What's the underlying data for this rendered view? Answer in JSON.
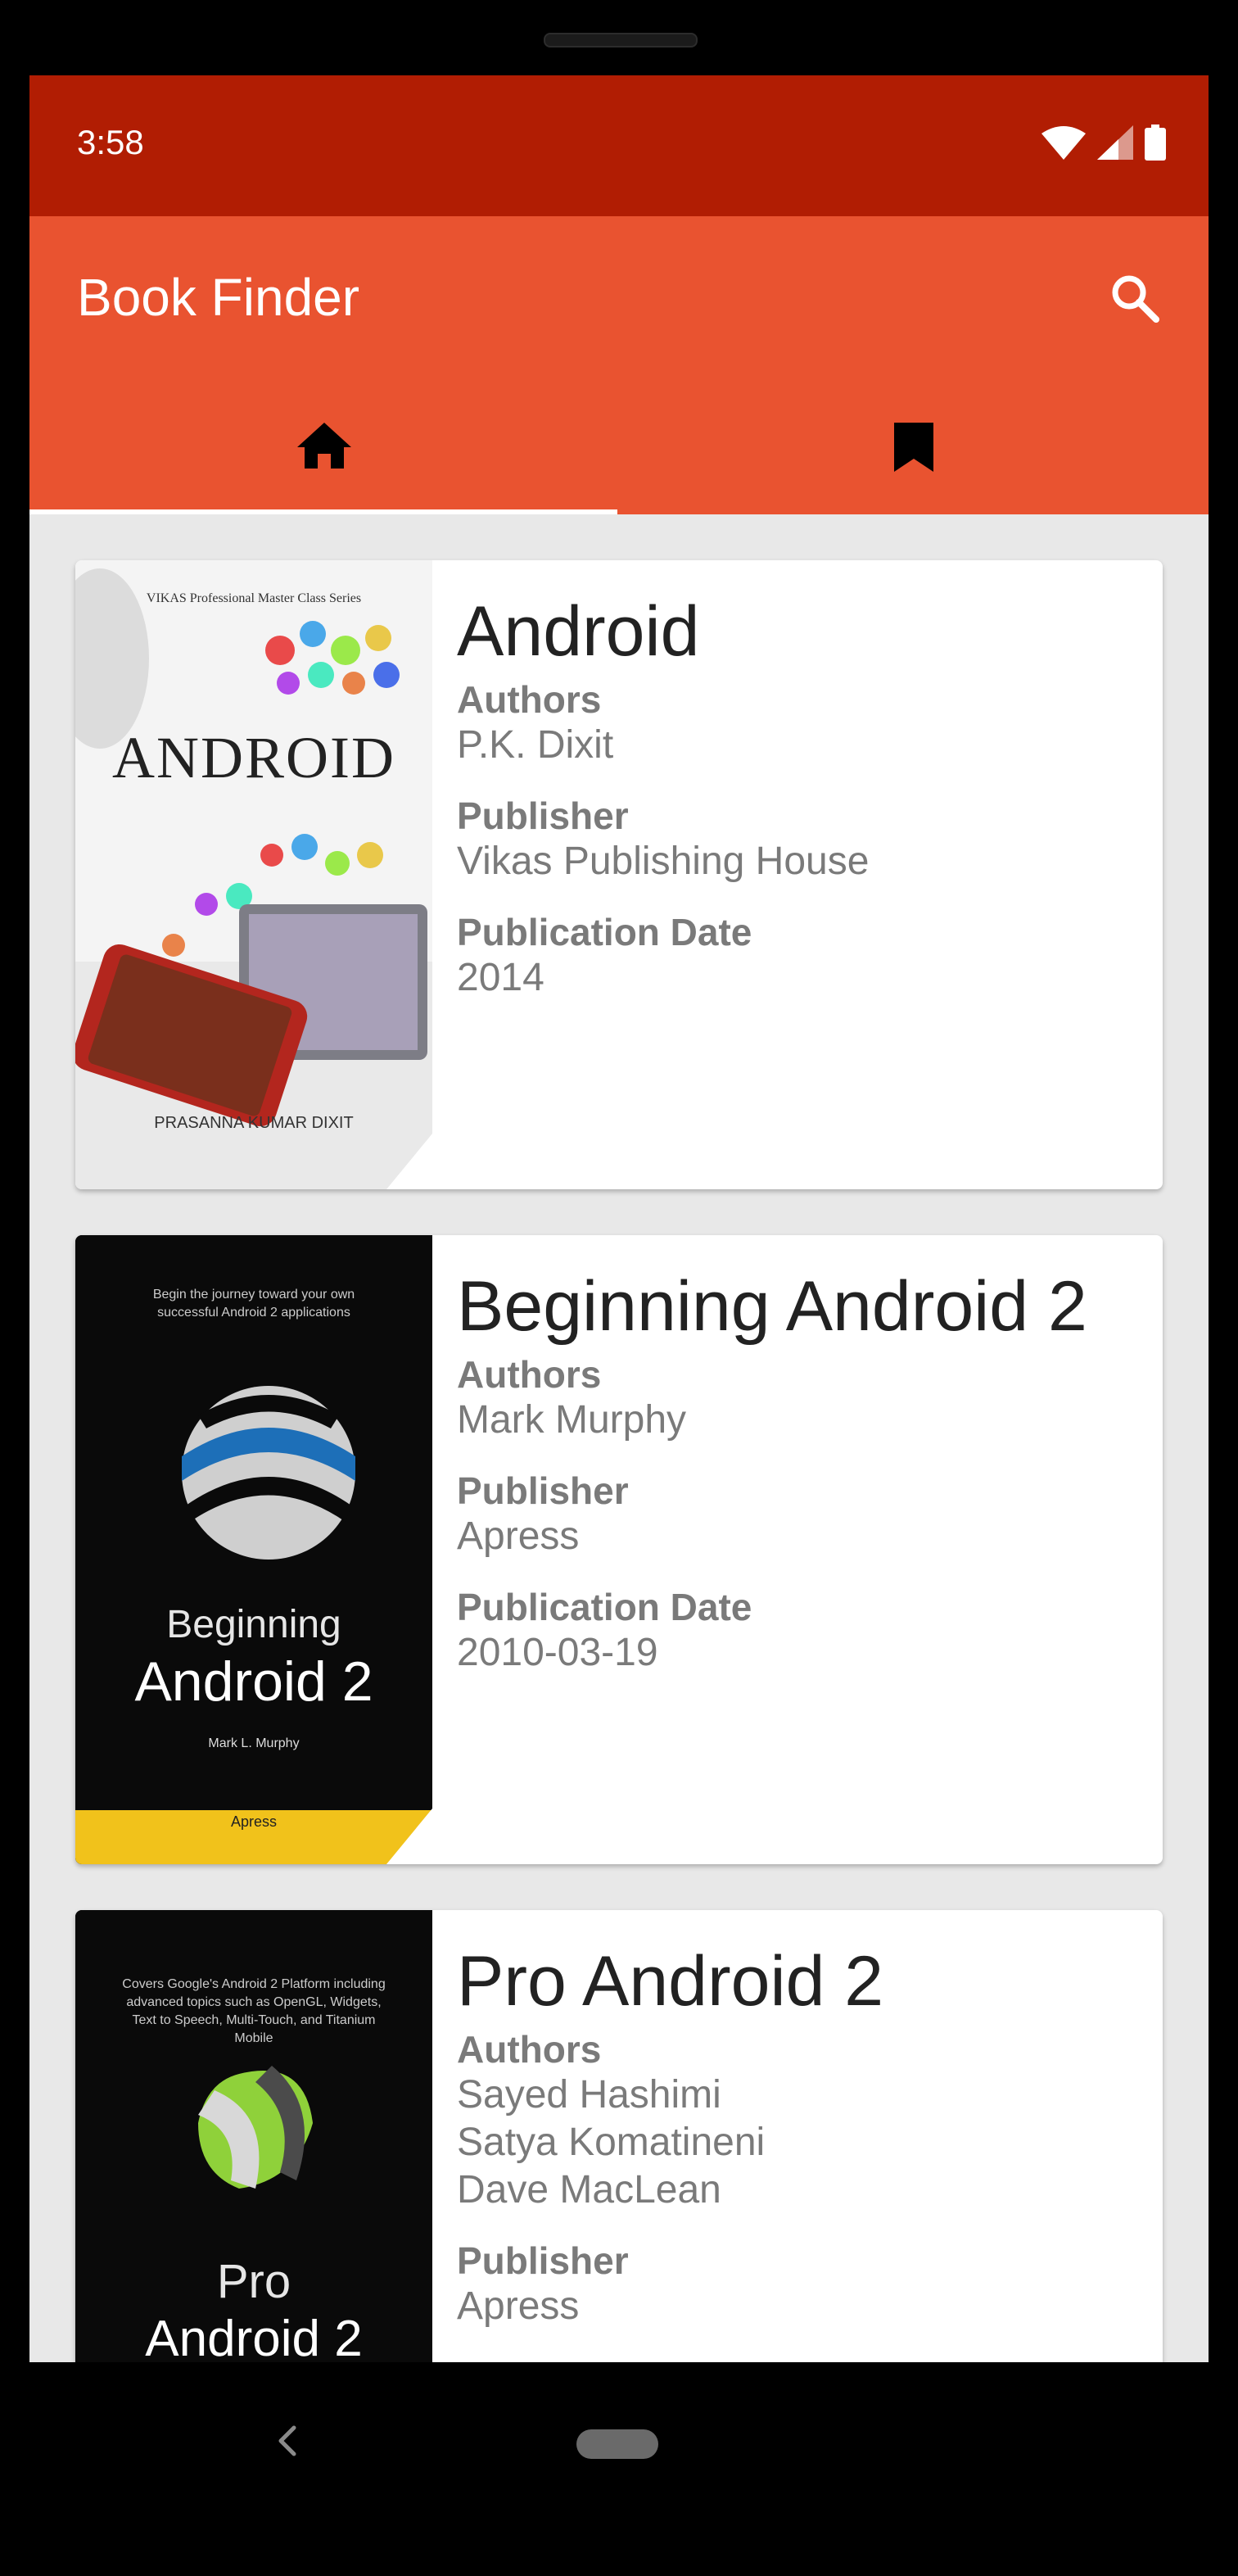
{
  "status_bar": {
    "time": "3:58"
  },
  "app_bar": {
    "title": "Book Finder"
  },
  "tabs": [
    {
      "name": "home",
      "icon": "home-icon",
      "active": true
    },
    {
      "name": "bookmarks",
      "icon": "bookmark-icon",
      "active": false
    }
  ],
  "colors": {
    "status_bar": "#b11d03",
    "app_bar": "#e95330",
    "background": "#e8e8e8"
  },
  "books": [
    {
      "title": "Android",
      "authors_label": "Authors",
      "authors": [
        "P.K. Dixit"
      ],
      "publisher_label": "Publisher",
      "publisher": "Vikas Publishing House",
      "date_label": "Publication Date",
      "date": "2014",
      "cover": {
        "series": "VIKAS Professional Master Class Series",
        "title": "ANDROID",
        "author": "PRASANNA KUMAR DIXIT"
      }
    },
    {
      "title": "Beginning Android 2",
      "authors_label": "Authors",
      "authors": [
        "Mark Murphy"
      ],
      "publisher_label": "Publisher",
      "publisher": "Apress",
      "date_label": "Publication Date",
      "date": "2010-03-19",
      "cover": {
        "tagline": "Begin the journey toward your own successful Android 2 applications",
        "title_line1": "Beginning",
        "title_line2": "Android 2",
        "author": "Mark L. Murphy",
        "publisher": "Apress"
      }
    },
    {
      "title": "Pro Android 2",
      "authors_label": "Authors",
      "authors": [
        "Sayed Hashimi",
        "Satya Komatineni",
        "Dave MacLean"
      ],
      "publisher_label": "Publisher",
      "publisher": "Apress",
      "cover": {
        "tagline": "Covers Google's Android 2 Platform including advanced topics such as OpenGL, Widgets, Text to Speech, Multi-Touch, and Titanium Mobile",
        "title_line1": "Pro",
        "title_line2": "Android 2"
      }
    }
  ]
}
